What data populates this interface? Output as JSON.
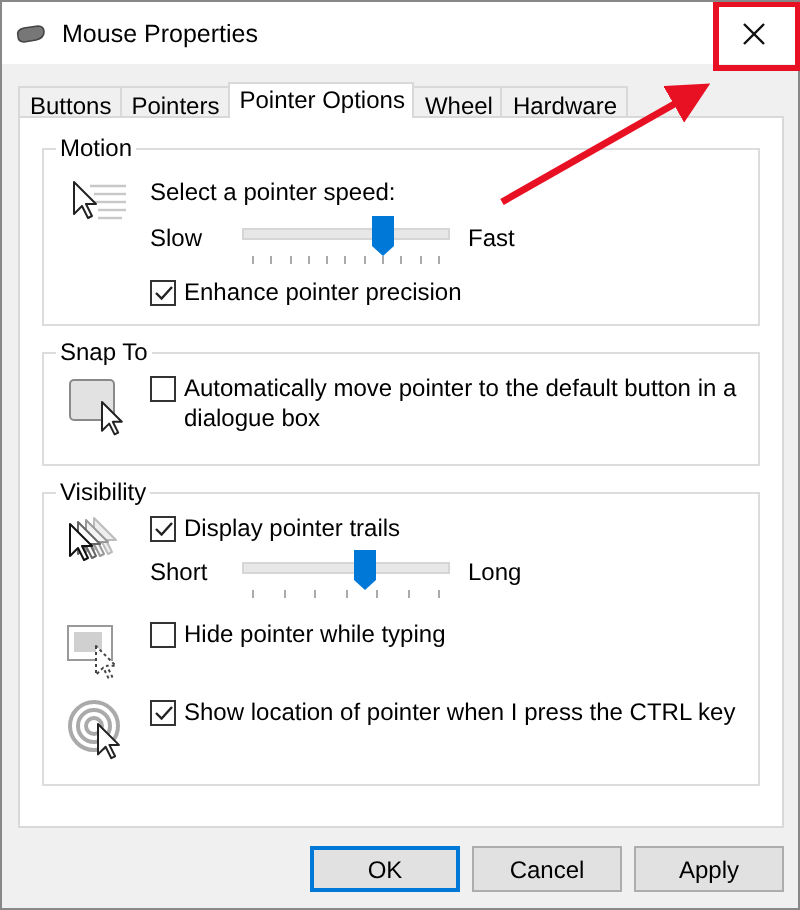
{
  "window": {
    "title": "Mouse Properties"
  },
  "tabs": [
    {
      "label": "Buttons",
      "selected": false
    },
    {
      "label": "Pointers",
      "selected": false
    },
    {
      "label": "Pointer Options",
      "selected": true
    },
    {
      "label": "Wheel",
      "selected": false
    },
    {
      "label": "Hardware",
      "selected": false
    }
  ],
  "sections": [
    {
      "title": "Motion",
      "blocks": [
        {
          "kind": "speed",
          "rows": [
            {
              "kind": "text",
              "text": "Select a pointer speed:"
            },
            {
              "kind": "slider",
              "min_label": "Slow",
              "max_label": "Fast",
              "level": 0.7
            },
            {
              "kind": "checkbox",
              "label": "Enhance pointer precision",
              "checked": true
            }
          ]
        }
      ]
    },
    {
      "title": "Snap To",
      "blocks": [
        {
          "kind": "snap",
          "rows": [
            {
              "kind": "checkbox",
              "label": "Automatically move pointer to the default button in a dialogue box",
              "checked": false
            }
          ]
        }
      ]
    },
    {
      "title": "Visibility",
      "blocks": [
        {
          "kind": "trails",
          "rows": [
            {
              "kind": "checkbox",
              "label": "Display pointer trails",
              "checked": true
            },
            {
              "kind": "slider",
              "min_label": "Short",
              "max_label": "Long",
              "level": 0.6
            }
          ]
        },
        {
          "kind": "hide",
          "rows": [
            {
              "kind": "checkbox",
              "label": "Hide pointer while typing",
              "checked": false
            }
          ]
        },
        {
          "kind": "locate",
          "rows": [
            {
              "kind": "checkbox",
              "label": "Show location of pointer when I press the CTRL key",
              "checked": true
            }
          ]
        }
      ]
    }
  ],
  "buttons": [
    "OK",
    "Cancel",
    "Apply"
  ]
}
